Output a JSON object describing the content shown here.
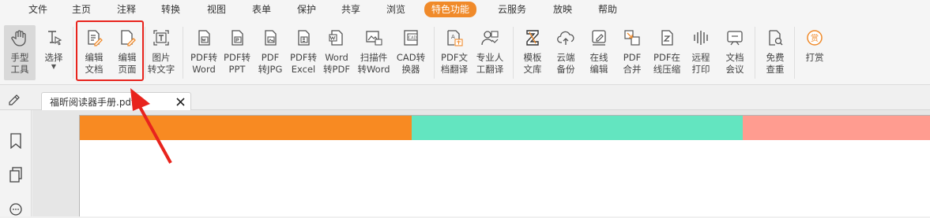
{
  "menu": {
    "items": [
      "文件",
      "主页",
      "注释",
      "转换",
      "视图",
      "表单",
      "保护",
      "共享",
      "浏览",
      "特色功能",
      "云服务",
      "放映",
      "帮助"
    ],
    "active_index": 9
  },
  "toolbar": {
    "hand": "手型\n工具",
    "select": "选择",
    "edit_doc": "编辑\n文档",
    "edit_page": "编辑\n页面",
    "img_to_text": "图片\n转文字",
    "pdf_word": "PDF转\nWord",
    "pdf_ppt": "PDF转\nPPT",
    "pdf_jpg": "PDF\n转JPG",
    "pdf_excel": "PDF转\nExcel",
    "word_pdf": "Word\n转PDF",
    "scan_word": "扫描件\n转Word",
    "cad_conv": "CAD转\n换器",
    "pdf_translate": "PDF文\n档翻译",
    "human_translate": "专业人\n工翻译",
    "template": "模板\n文库",
    "cloud_backup": "云端\n备份",
    "online_edit": "在线\n编辑",
    "pdf_merge": "PDF\n合并",
    "pdf_compress": "PDF在\n线压缩",
    "remote_print": "远程\n打印",
    "doc_meeting": "文档\n会议",
    "free_check": "免费\n查重",
    "reward": "打赏"
  },
  "tab": {
    "title": "福昕阅读器手册.pdf *"
  },
  "colors": {
    "accent": "#f08a2a",
    "band_orange": "#f88a22",
    "band_teal": "#63e5c0",
    "band_pink": "#ff9c90",
    "highlight_red": "#e8241d"
  }
}
